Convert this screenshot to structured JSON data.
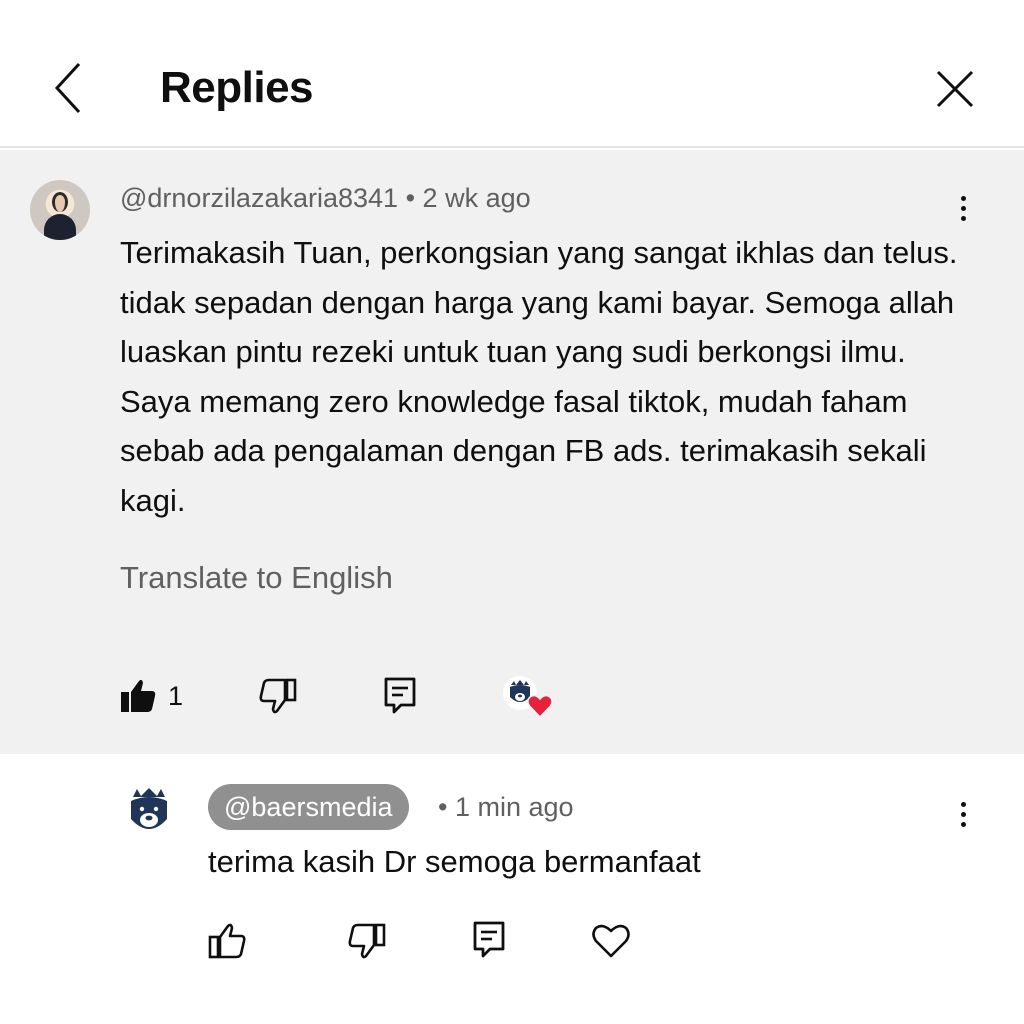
{
  "header": {
    "title": "Replies"
  },
  "parent_comment": {
    "author": "@drnorzilazakaria8341",
    "separator": "•",
    "time": "2 wk ago",
    "text": "Terimakasih Tuan, perkongsian yang sangat ikhlas dan telus. tidak sepadan dengan harga yang kami bayar. Semoga allah luaskan pintu rezeki untuk tuan yang sudi berkongsi ilmu. Saya memang zero knowledge fasal tiktok, mudah faham sebab ada pengalaman dengan FB ads. terimakasih sekali kagi.",
    "translate_label": "Translate to English",
    "like_count": "1",
    "liked": true,
    "creator_hearted": true
  },
  "reply": {
    "author": "@baersmedia",
    "separator": "•",
    "time": "1 min ago",
    "text": "terima kasih Dr semoga bermanfaat"
  },
  "colors": {
    "background": "#ffffff",
    "parent_background": "#f1f1f1",
    "secondary_text": "#606060",
    "handle_pill": "#909090",
    "heart": "#e8203a",
    "bear_navy": "#1f3559"
  },
  "icons": [
    "back-arrow-icon",
    "close-icon",
    "more-vert-icon",
    "thumb-up-filled-icon",
    "thumb-down-icon",
    "reply-comment-icon",
    "creator-heart-icon",
    "thumb-up-icon",
    "heart-outline-icon"
  ]
}
